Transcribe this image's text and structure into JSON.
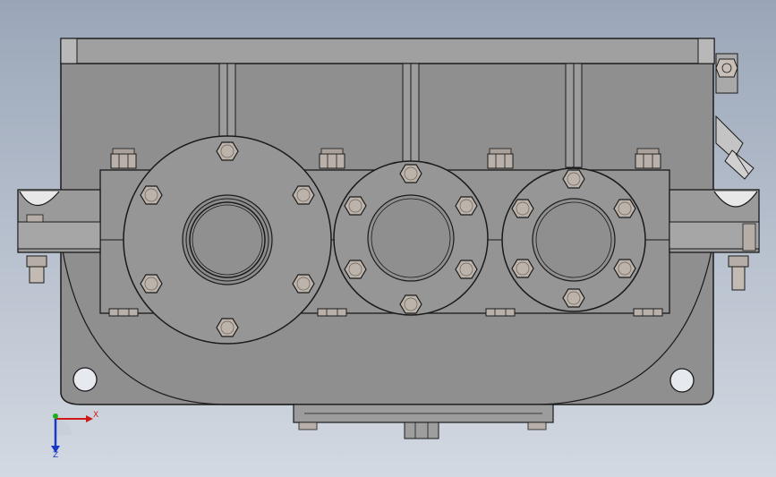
{
  "triad": {
    "x_label": "X",
    "z_label": "Z",
    "colors": {
      "x": "#d01818",
      "y": "#18b018",
      "z": "#1838c8"
    }
  },
  "colors": {
    "background_top": "#9aa6b8",
    "background_bottom": "#d3d9e2",
    "housing": "#8f8f8f",
    "housing_light": "#a3a3a3",
    "edge": "#1a1a1a",
    "bolt": "#b8b0a8"
  }
}
